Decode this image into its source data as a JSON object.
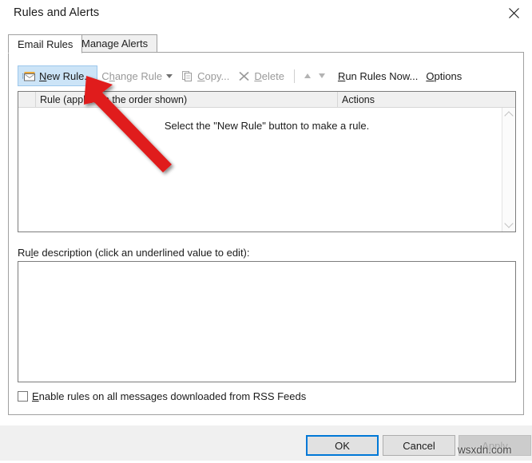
{
  "window": {
    "title": "Rules and Alerts",
    "close_icon": "close-icon"
  },
  "tabs": [
    {
      "label": "Email Rules",
      "active": true
    },
    {
      "label": "Manage Alerts",
      "active": false
    }
  ],
  "toolbar": {
    "items": [
      {
        "label": "New Rule...",
        "accel": "N",
        "icon": "new-rule-envelope-icon",
        "state": "highlighted"
      },
      {
        "label": "Change Rule",
        "accel": "h",
        "icon": "chevron-down-icon",
        "state": "disabled"
      },
      {
        "label": "Copy...",
        "accel": "C",
        "icon": "copy-pages-icon",
        "state": "disabled"
      },
      {
        "label": "Delete",
        "accel": "D",
        "icon": "x-delete-icon",
        "state": "disabled"
      },
      {
        "label": "Move Up",
        "icon": "triangle-up-icon",
        "state": "disabled"
      },
      {
        "label": "Move Down",
        "icon": "triangle-down-icon",
        "state": "disabled"
      },
      {
        "label": "Run Rules Now...",
        "accel": "R",
        "state": "normal"
      },
      {
        "label": "Options",
        "accel": "O",
        "state": "normal"
      }
    ],
    "new_rule_label": "New Rule...",
    "change_rule_label": "Change Rule",
    "copy_label": "Copy...",
    "delete_label": "Delete",
    "run_rules_now_label": "Run Rules Now...",
    "options_label": "Options"
  },
  "rules_list": {
    "columns": [
      {
        "key": "check",
        "label": ""
      },
      {
        "key": "rule",
        "label": "Rule (applied in the order shown)"
      },
      {
        "key": "actions",
        "label": "Actions"
      }
    ],
    "rows": [],
    "empty_message": "Select the \"New Rule\" button to make a rule.",
    "scrollbar": {
      "up_icon": "chevron-up-icon",
      "down_icon": "chevron-down-icon"
    }
  },
  "rule_description": {
    "label": "Rule description (click an underlined value to edit):",
    "value": ""
  },
  "rss_checkbox": {
    "label": "Enable rules on all messages downloaded from RSS Feeds",
    "checked": false
  },
  "footer": {
    "ok_label": "OK",
    "cancel_label": "Cancel",
    "apply_label": "Apply",
    "apply_enabled": false
  },
  "annotation": {
    "arrow_color": "#e01b1b",
    "watermark": "wsxdn.com"
  },
  "colors": {
    "accent": "#0078d7",
    "highlight_fill": "#cce4f7",
    "highlight_border": "#9cc7ec",
    "dialog_bg": "#ffffff",
    "footer_bg": "#f0f0f0",
    "border": "#a0a0a0"
  }
}
